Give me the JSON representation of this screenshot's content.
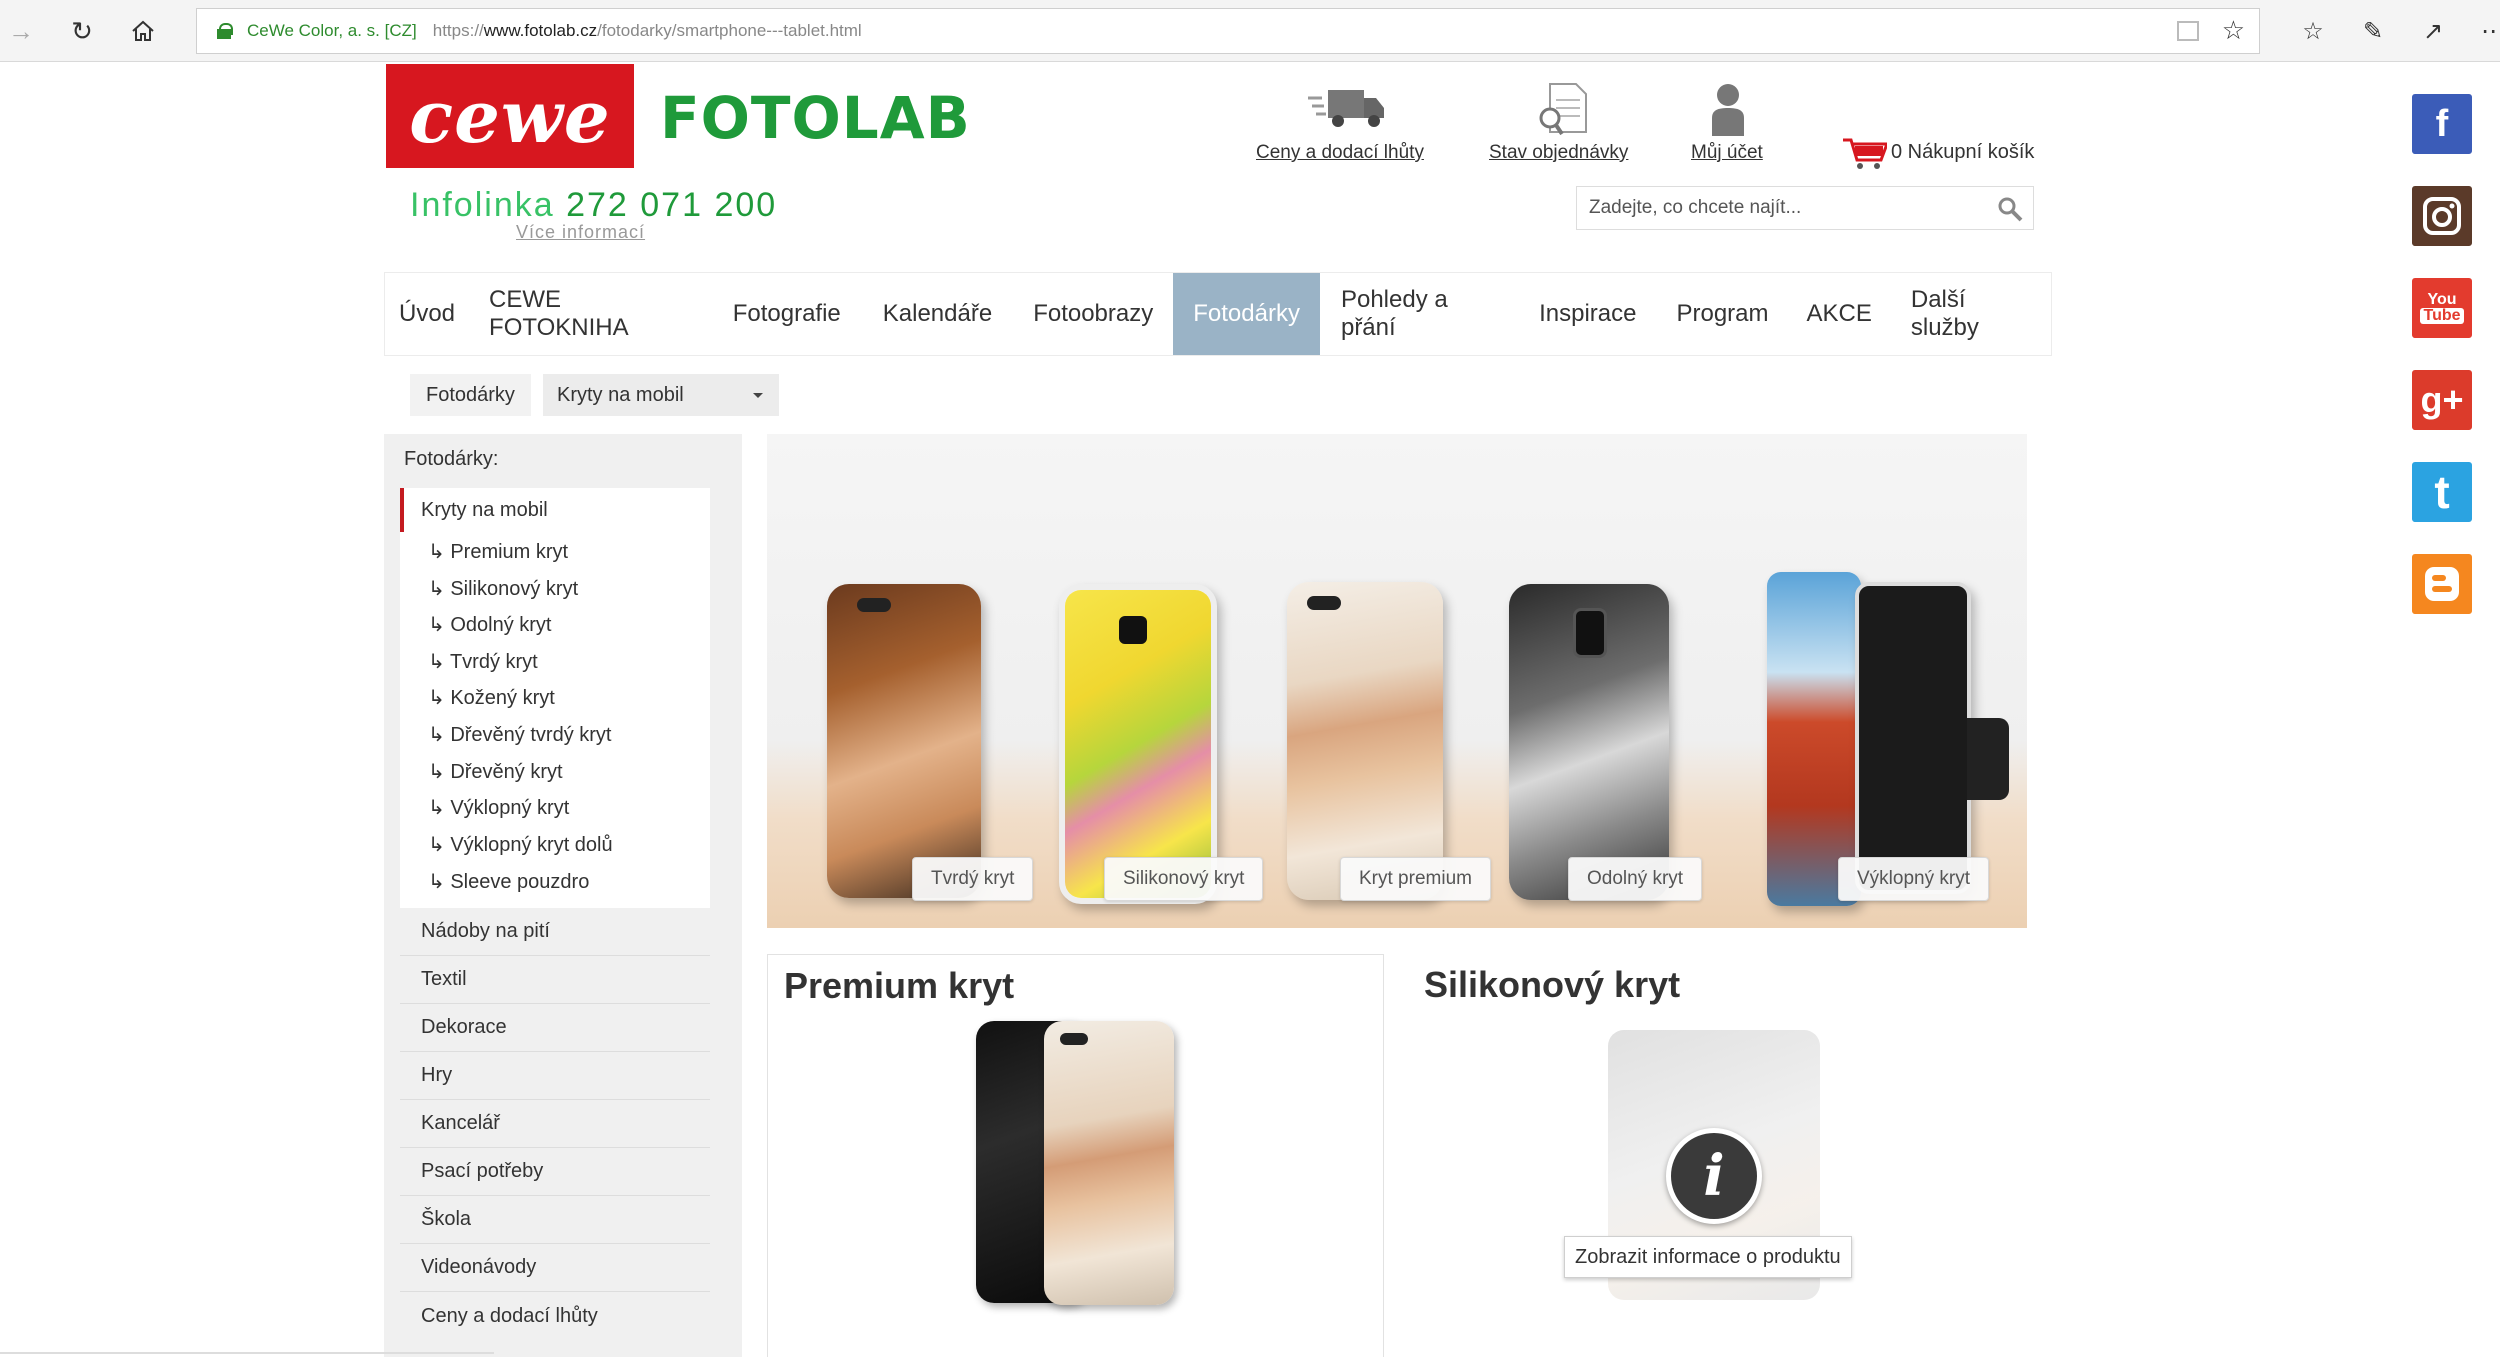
{
  "browser": {
    "site_identity": "CeWe Color, a. s. [CZ]",
    "url_prefix": "https://",
    "url_domain": "www.fotolab.cz",
    "url_path": "/fotodarky/smartphone---tablet.html"
  },
  "header": {
    "logo_brand": "cewe",
    "logo_name": "FOTOLAB",
    "infolinka_label": "Infolinka",
    "infolinka_number": "272 071 200",
    "more_info": "Více informací",
    "links": {
      "prices": "Ceny a dodací lhůty",
      "order_status": "Stav objednávky",
      "account": "Můj účet"
    },
    "cart": "0 Nákupní košík",
    "search_placeholder": "Zadejte, co chcete najít..."
  },
  "nav": {
    "items": [
      "Úvod",
      "CEWE FOTOKNIHA",
      "Fotografie",
      "Kalendáře",
      "Fotoobrazy",
      "Fotodárky",
      "Pohledy a přání",
      "Inspirace",
      "Program",
      "AKCE",
      "Další služby"
    ],
    "active": "Fotodárky"
  },
  "breadcrumb": {
    "home": "Fotodárky",
    "selected": "Kryty na mobil"
  },
  "sidebar": {
    "heading": "Fotodárky:",
    "current": "Kryty na mobil",
    "subitems": [
      "Premium kryt",
      "Silikonový kryt",
      "Odolný kryt",
      "Tvrdý kryt",
      "Kožený kryt",
      "Dřevěný tvrdý kryt",
      "Dřevěný kryt",
      "Výklopný kryt",
      "Výklopný kryt dolů",
      "Sleeve pouzdro"
    ],
    "categories": [
      "Nádoby na pití",
      "Textil",
      "Dekorace",
      "Hry",
      "Kancelář",
      "Psací potřeby",
      "Škola",
      "Videonávody",
      "Ceny a dodací lhůty"
    ]
  },
  "banner": {
    "labels": [
      "Tvrdý kryt",
      "Silikonový kryt",
      "Kryt premium",
      "Odolný kryt",
      "Výklopný kryt"
    ]
  },
  "products": [
    {
      "title": "Premium kryt"
    },
    {
      "title": "Silikonový kryt",
      "info_tooltip": "Zobrazit informace o produktu"
    }
  ],
  "colors": {
    "brand_red": "#d7171f",
    "brand_green": "#1f9a3a",
    "nav_active": "#9ab3c6"
  },
  "social": [
    "facebook-icon",
    "instagram-icon",
    "youtube-icon",
    "google-plus-icon",
    "twitter-icon",
    "blogger-icon"
  ]
}
